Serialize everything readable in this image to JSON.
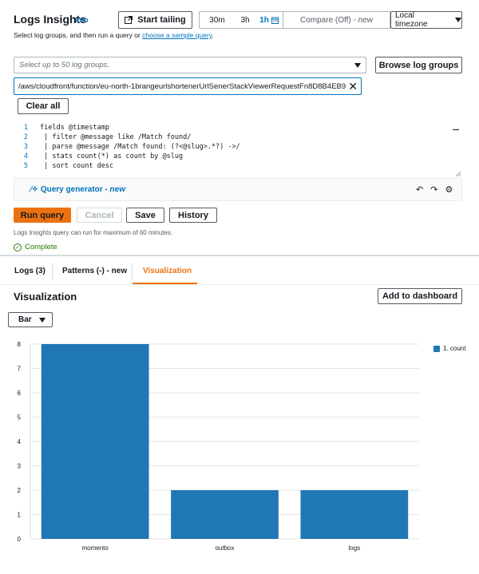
{
  "header": {
    "title": "Logs Insights",
    "info": "Info",
    "subtitle_prefix": "Select log groups, and then run a query or ",
    "subtitle_link": "choose a sample query",
    "subtitle_suffix": "."
  },
  "toolbar": {
    "start_tailing": "Start tailing",
    "time_options": [
      "30m",
      "3h",
      "1h"
    ],
    "active_time": "1h",
    "compare_label": "Compare (Off) - ",
    "compare_new": "new",
    "timezone": "Local timezone"
  },
  "log_groups": {
    "placeholder": "Select up to 50 log groups.",
    "browse": "Browse log groups",
    "selected": "/aws/cloudfront/function/eu-north-1brangeurlshortenerUrlSenerStackViewerRequestFn8D8B4EB9",
    "clear_all": "Clear all"
  },
  "editor": {
    "lines": [
      {
        "n": "1",
        "text": "fields @timestamp"
      },
      {
        "n": "2",
        "text": " | filter @message like /Match found/"
      },
      {
        "n": "3",
        "text": " | parse @message /Match found: (?<@slug>.*?) ->/"
      },
      {
        "n": "4",
        "text": " | stats count(*) as count by @slug"
      },
      {
        "n": "5",
        "text": " | sort count desc"
      }
    ],
    "query_generator": "Query generator - ",
    "query_generator_new": "new"
  },
  "actions": {
    "run": "Run query",
    "cancel": "Cancel",
    "save": "Save",
    "history": "History",
    "note": "Logs Insights query can run for maximum of 60 minutes.",
    "status": "Complete"
  },
  "tabs": [
    {
      "label": "Logs (3)"
    },
    {
      "label": "Patterns (-) - new"
    },
    {
      "label": "Visualization"
    }
  ],
  "visualization": {
    "title": "Visualization",
    "add_to_dashboard": "Add to dashboard",
    "chart_type_label": "Bar"
  },
  "colors": {
    "accent": "#ec7211",
    "link": "#0073bb",
    "bar": "#1f77b4",
    "success": "#1d8102"
  },
  "chart_data": {
    "type": "bar",
    "categories": [
      "momento",
      "outbox",
      "logs"
    ],
    "series": [
      {
        "name": "1. count",
        "values": [
          8,
          2,
          2
        ]
      }
    ],
    "ylim": [
      0,
      8
    ],
    "yticks": [
      0,
      1,
      2,
      3,
      4,
      5,
      6,
      7,
      8
    ],
    "grid": true,
    "legend": "top-right"
  }
}
